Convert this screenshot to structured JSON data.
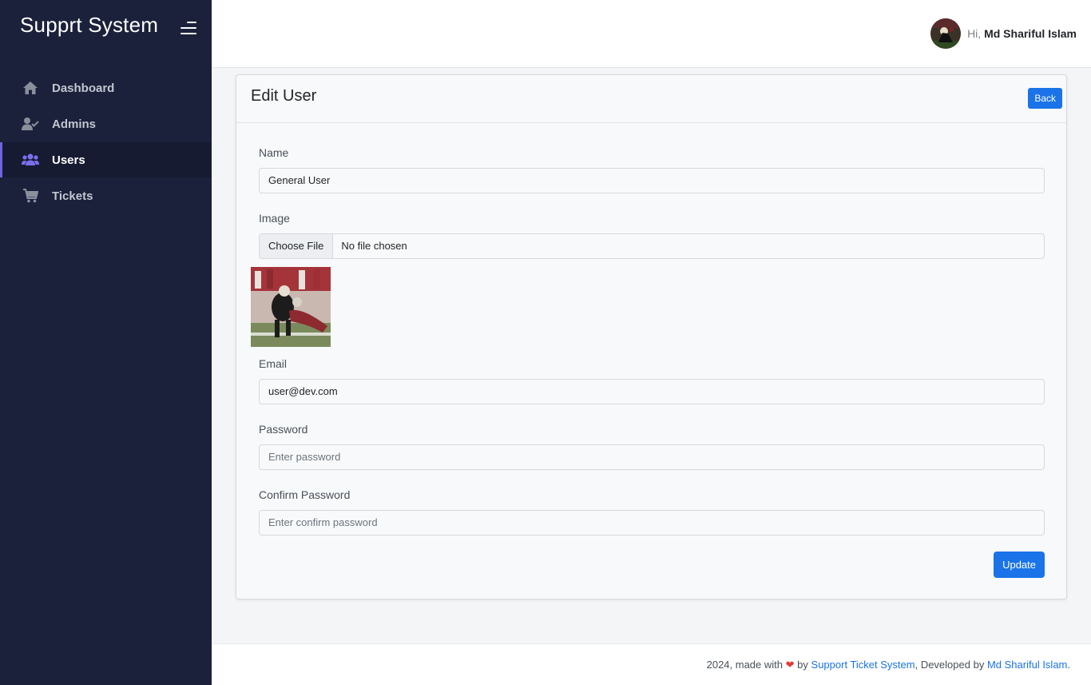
{
  "sidebar": {
    "brand": "Supprt System",
    "items": [
      {
        "label": "Dashboard",
        "icon": "home-icon"
      },
      {
        "label": "Admins",
        "icon": "user-check-icon"
      },
      {
        "label": "Users",
        "icon": "users-icon",
        "active": true
      },
      {
        "label": "Tickets",
        "icon": "cart-icon"
      }
    ]
  },
  "header": {
    "greeting": "Hi,",
    "user_name": "Md Shariful Islam"
  },
  "card": {
    "title": "Edit User",
    "back_label": "Back",
    "fields": {
      "name_label": "Name",
      "name_value": "General User",
      "image_label": "Image",
      "file_button": "Choose File",
      "file_status": "No file chosen",
      "email_label": "Email",
      "email_value": "user@dev.com",
      "password_label": "Password",
      "password_placeholder": "Enter password",
      "confirm_label": "Confirm Password",
      "confirm_placeholder": "Enter confirm password"
    },
    "update_label": "Update"
  },
  "footer": {
    "prefix": "2024, made with",
    "by": "by",
    "system_link": "Support Ticket System",
    "developed_by": ", Developed by",
    "developer_link": "Md Shariful Islam",
    "suffix": "."
  },
  "colors": {
    "sidebar_bg": "#1b213b",
    "accent": "#1a73e8",
    "active_marker": "#6f63e0"
  }
}
